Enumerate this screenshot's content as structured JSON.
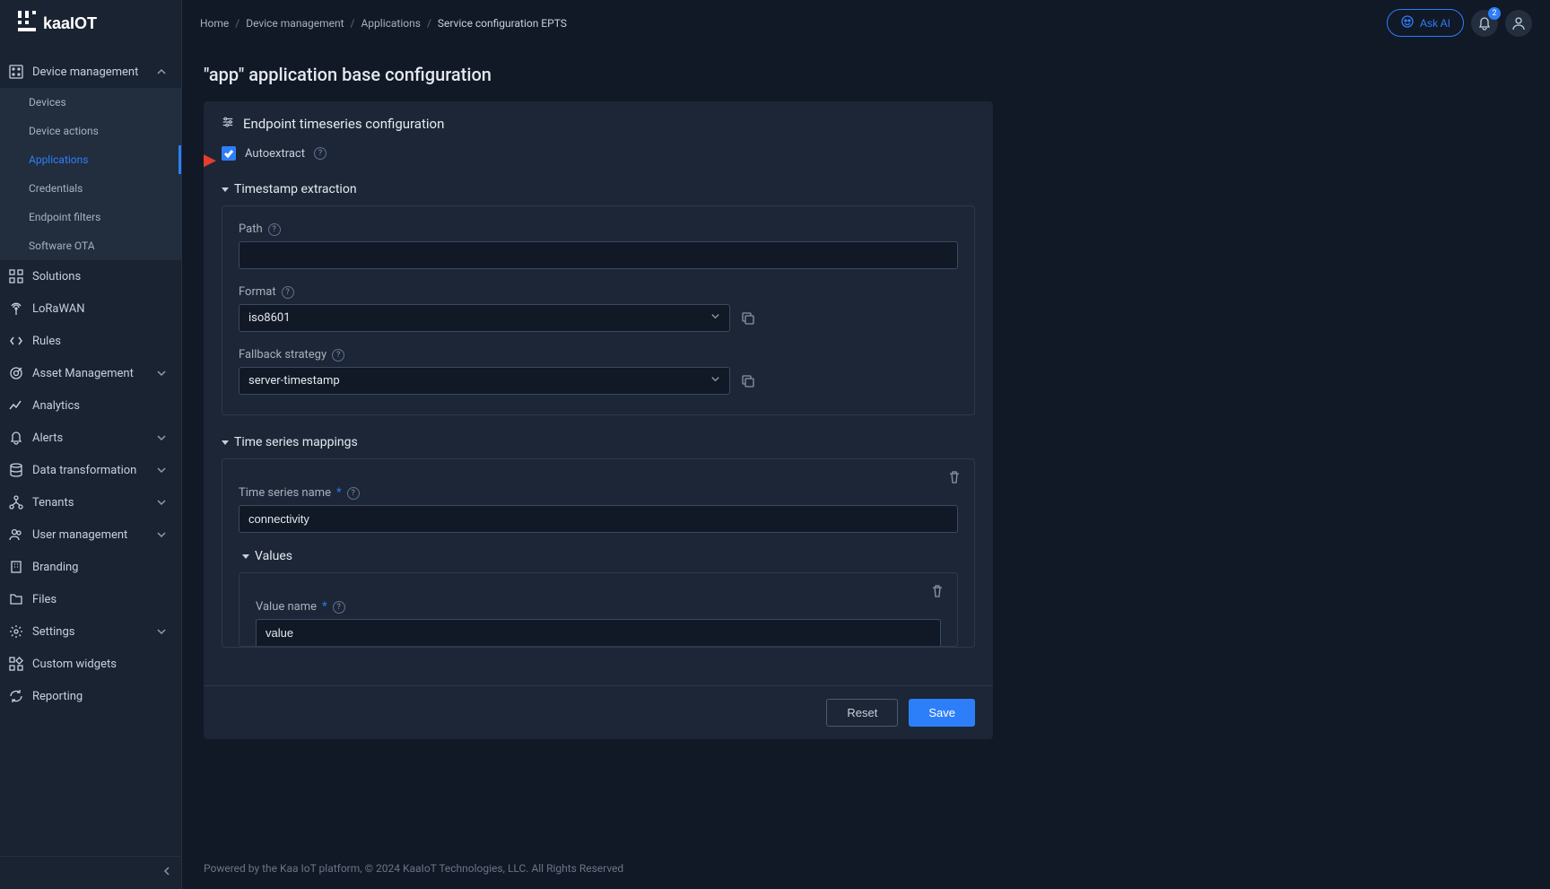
{
  "brand": "kaaIOT",
  "topbar": {
    "askAiLabel": "Ask AI",
    "notificationCount": "2"
  },
  "breadcrumbs": [
    {
      "label": "Home"
    },
    {
      "label": "Device management"
    },
    {
      "label": "Applications"
    },
    {
      "label": "Service configuration EPTS",
      "current": true
    }
  ],
  "sidebar": {
    "sections": [
      {
        "label": "Device management",
        "icon": "devices",
        "expanded": true,
        "items": [
          {
            "label": "Devices"
          },
          {
            "label": "Device actions"
          },
          {
            "label": "Applications",
            "active": true
          },
          {
            "label": "Credentials"
          },
          {
            "label": "Endpoint filters"
          },
          {
            "label": "Software OTA"
          }
        ]
      },
      {
        "label": "Solutions",
        "icon": "grid"
      },
      {
        "label": "LoRaWAN",
        "icon": "antenna"
      },
      {
        "label": "Rules",
        "icon": "code"
      },
      {
        "label": "Asset Management",
        "icon": "target",
        "expandable": true
      },
      {
        "label": "Analytics",
        "icon": "chart"
      },
      {
        "label": "Alerts",
        "icon": "bell",
        "expandable": true
      },
      {
        "label": "Data transformation",
        "icon": "database",
        "expandable": true
      },
      {
        "label": "Tenants",
        "icon": "tree",
        "expandable": true
      },
      {
        "label": "User management",
        "icon": "users",
        "expandable": true
      },
      {
        "label": "Branding",
        "icon": "building"
      },
      {
        "label": "Files",
        "icon": "folder"
      },
      {
        "label": "Settings",
        "icon": "gear",
        "expandable": true
      },
      {
        "label": "Custom widgets",
        "icon": "widgets"
      },
      {
        "label": "Reporting",
        "icon": "refresh"
      }
    ]
  },
  "page": {
    "title": "\"app\" application base configuration",
    "panelTitle": "Endpoint timeseries configuration",
    "autoextractLabel": "Autoextract",
    "autoextractChecked": true,
    "timestampSectionLabel": "Timestamp extraction",
    "pathLabel": "Path",
    "pathValue": "",
    "formatLabel": "Format",
    "formatValue": "iso8601",
    "fallbackLabel": "Fallback strategy",
    "fallbackValue": "server-timestamp",
    "mappingsSectionLabel": "Time series mappings",
    "tsNameLabel": "Time series name",
    "tsNameValue": "connectivity",
    "valuesLabel": "Values",
    "valueNameLabel": "Value name",
    "valueNameValue": "value",
    "resetLabel": "Reset",
    "saveLabel": "Save"
  },
  "footer": "Powered by the Kaa IoT platform, © 2024 KaaIoT Technologies, LLC. All Rights Reserved"
}
